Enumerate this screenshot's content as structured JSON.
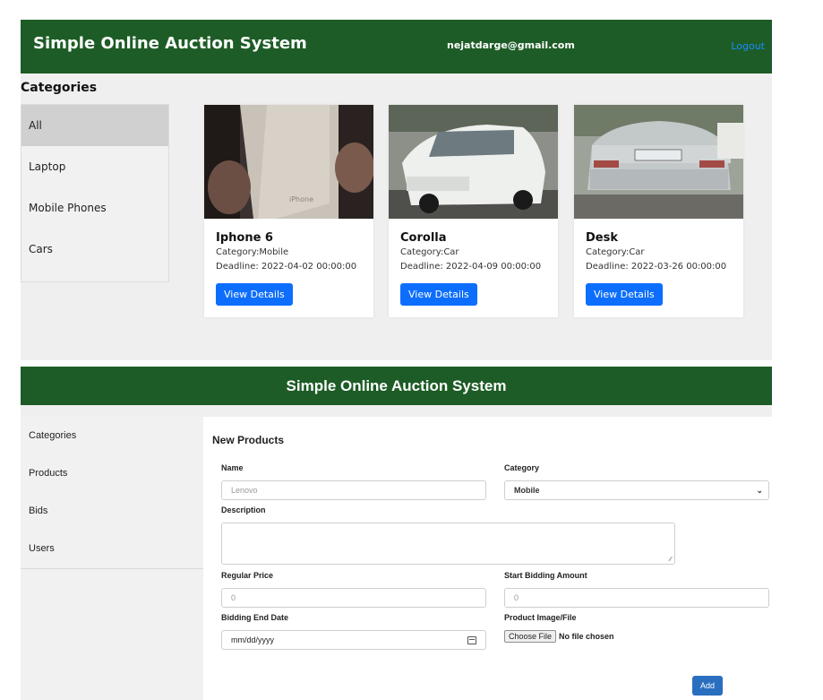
{
  "top": {
    "brand": "Simple Online Auction System",
    "user_email": "nejatdarge@gmail.com",
    "logout_label": "Logout",
    "categories_title": "Categories",
    "categories": [
      "All",
      "Laptop",
      "Mobile Phones",
      "Cars"
    ],
    "products": [
      {
        "title": "Iphone 6",
        "category": "Category:Mobile",
        "deadline": "Deadline: 2022-04-02 00:00:00",
        "button": "View Details"
      },
      {
        "title": "Corolla",
        "category": "Category:Car",
        "deadline": "Deadline: 2022-04-09 00:00:00",
        "button": "View Details"
      },
      {
        "title": "Desk",
        "category": "Category:Car",
        "deadline": "Deadline: 2022-03-26 00:00:00",
        "button": "View Details"
      }
    ]
  },
  "admin": {
    "header": "Simple Online Auction System",
    "sidebar": [
      "Categories",
      "Products",
      "Bids",
      "Users"
    ],
    "form": {
      "title": "New Products",
      "name_label": "Name",
      "name_placeholder": "Lenovo",
      "category_label": "Category",
      "category_value": "Mobile",
      "description_label": "Description",
      "regular_price_label": "Regular Price",
      "regular_price_placeholder": "0",
      "start_bid_label": "Start Bidding Amount",
      "start_bid_placeholder": "0",
      "end_date_label": "Bidding End Date",
      "end_date_value": "mm/dd/yyyy",
      "image_label": "Product Image/File",
      "choose_file": "Choose File",
      "no_file": "No file chosen",
      "add_button": "Add"
    }
  },
  "icons": {
    "chevron": "chevron-down-icon",
    "calendar": "calendar-icon",
    "resize": "resize-grip-icon"
  },
  "colors": {
    "nav_green": "#1d5c26",
    "primary_blue": "#0d6efd",
    "link_blue": "#1a8cff"
  }
}
